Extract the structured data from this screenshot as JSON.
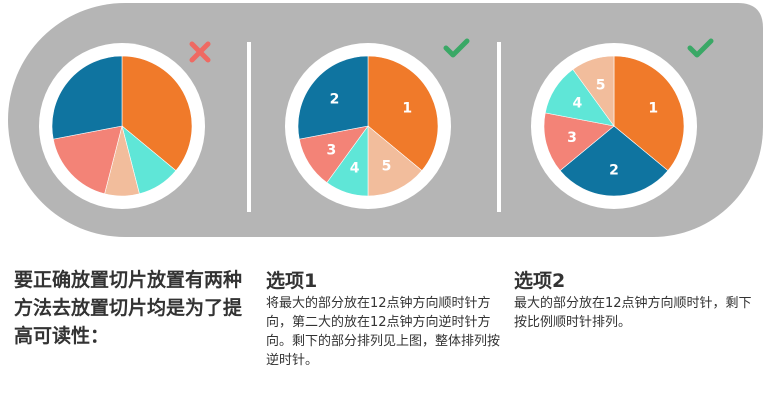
{
  "colors": {
    "band": "#b5b5b5",
    "divider": "#ffffff",
    "orange": "#f07a2a",
    "blue": "#0f74a0",
    "salmon": "#f38377",
    "aqua": "#5fe6d7",
    "peach": "#f2bd9c",
    "cross": "#ef6a63",
    "check": "#3aa866",
    "text": "#333333"
  },
  "icons": [
    "cross-icon",
    "check-icon",
    "check-icon"
  ],
  "chart_data": [
    {
      "type": "pie",
      "name": "wrong-example",
      "values": [
        36,
        28,
        18,
        10,
        8
      ],
      "segment_colors": [
        "#f07a2a",
        "#0f74a0",
        "#f38377",
        "#5fe6d7",
        "#f2bd9c"
      ],
      "labels": [
        "",
        "",
        "",
        "",
        ""
      ]
    },
    {
      "type": "pie",
      "name": "option-1-example",
      "values": [
        36,
        28,
        12,
        10,
        14
      ],
      "segment_colors": [
        "#f07a2a",
        "#0f74a0",
        "#f38377",
        "#5fe6d7",
        "#f2bd9c"
      ],
      "labels": [
        "1",
        "2",
        "3",
        "4",
        "5"
      ]
    },
    {
      "type": "pie",
      "name": "option-2-example",
      "values": [
        36,
        28,
        14,
        12,
        10
      ],
      "segment_colors": [
        "#f07a2a",
        "#0f74a0",
        "#f38377",
        "#5fe6d7",
        "#f2bd9c"
      ],
      "labels": [
        "1",
        "2",
        "3",
        "4",
        "5"
      ]
    }
  ],
  "text": {
    "intro": "要正确放置切片放置有两种方法去放置切片均是为了提高可读性：",
    "option1_title": "选项1",
    "option1_body": "将最大的部分放在12点钟方向顺时针方向，第二大的放在12点钟方向逆时针方向。剩下的部分排列见上图，整体排列按逆时针。",
    "option2_title": "选项2",
    "option2_body": "最大的部分放在12点钟方向顺时针，剩下按比例顺时针排列。"
  }
}
